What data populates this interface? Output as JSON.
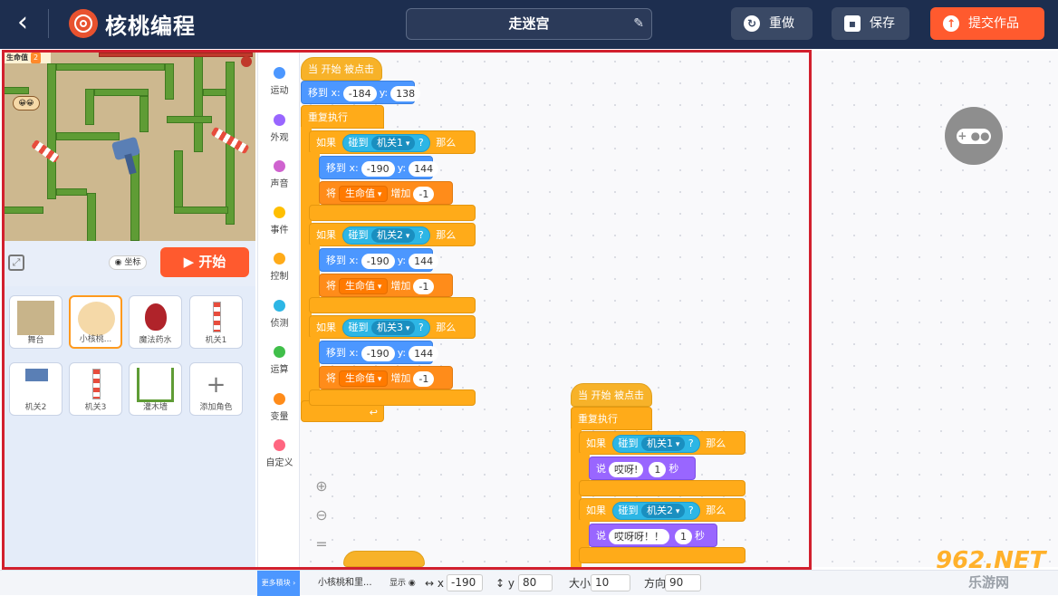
{
  "header": {
    "back_icon": "chevron-left-icon",
    "logo_icon": "walnut-logo-icon",
    "brand": "核桃编程",
    "project_title": "走迷宫",
    "edit_icon": "pencil-icon",
    "redo_label": "重做",
    "save_label": "保存",
    "submit_label": "提交作品"
  },
  "stage": {
    "hp_label": "生命值",
    "hp_value": "2"
  },
  "stage_controls": {
    "fullscreen_icon": "expand-icon",
    "coord_label": "坐标",
    "start_label": "开始"
  },
  "sprites": [
    {
      "name": "舞台"
    },
    {
      "name": "小核桃..."
    },
    {
      "name": "魔法药水"
    },
    {
      "name": "机关1"
    },
    {
      "name": "机关2"
    },
    {
      "name": "机关3"
    },
    {
      "name": "灌木墙"
    },
    {
      "name": "添加角色"
    }
  ],
  "categories": [
    {
      "label": "运动",
      "color": "#4c97ff"
    },
    {
      "label": "外观",
      "color": "#9966ff"
    },
    {
      "label": "声音",
      "color": "#cf63cf"
    },
    {
      "label": "事件",
      "color": "#ffbf00"
    },
    {
      "label": "控制",
      "color": "#ffab19"
    },
    {
      "label": "侦测",
      "color": "#2db6e5"
    },
    {
      "label": "运算",
      "color": "#40bf4a"
    },
    {
      "label": "变量",
      "color": "#ff8c1a"
    },
    {
      "label": "自定义",
      "color": "#ff6680"
    }
  ],
  "script1": {
    "hat": "当  开始  被点击",
    "goto_label": "移到 x:",
    "goto_x": "-184",
    "goto_y_label": "y:",
    "goto_y": "138",
    "forever": "重复执行",
    "if_label": "如果",
    "touch_label": "碰到",
    "q_mark": "?",
    "then_label": "那么",
    "trap1": "机关1",
    "trap2": "机关2",
    "trap3": "机关3",
    "move_label": "移到 x:",
    "move_x": "-190",
    "move_y_label": "y:",
    "move_y": "144",
    "set_label": "将",
    "var_name": "生命值",
    "change_label": "增加",
    "change_val": "-1",
    "loop_icon": "loop-arrow-icon"
  },
  "script2": {
    "hat": "当  开始  被点击",
    "forever": "重复执行",
    "if_label": "如果",
    "touch_label": "碰到",
    "trap1": "机关1",
    "trap2": "机关2",
    "q_mark": "?",
    "then_label": "那么",
    "say_label": "说",
    "say1": "哎呀!",
    "say2": "哎呀呀！！",
    "secs": "1",
    "secs_label": "秒"
  },
  "workspace": {
    "zoom_in_icon": "zoom-in-icon",
    "zoom_out_icon": "zoom-out-icon",
    "reset_icon": "equals-icon",
    "gamepad_icon": "gamepad-icon"
  },
  "bottom": {
    "more_blocks": "更多積块",
    "sprite_name": "小核桃和里...",
    "show_label": "显示",
    "x_label": "x",
    "x_value": "-190",
    "y_label": "y",
    "y_value": "80",
    "size_label": "大小",
    "size_value": "10",
    "dir_label": "方向",
    "dir_value": "90"
  },
  "watermark": {
    "num": "962.NET",
    "sub": "乐游网"
  }
}
